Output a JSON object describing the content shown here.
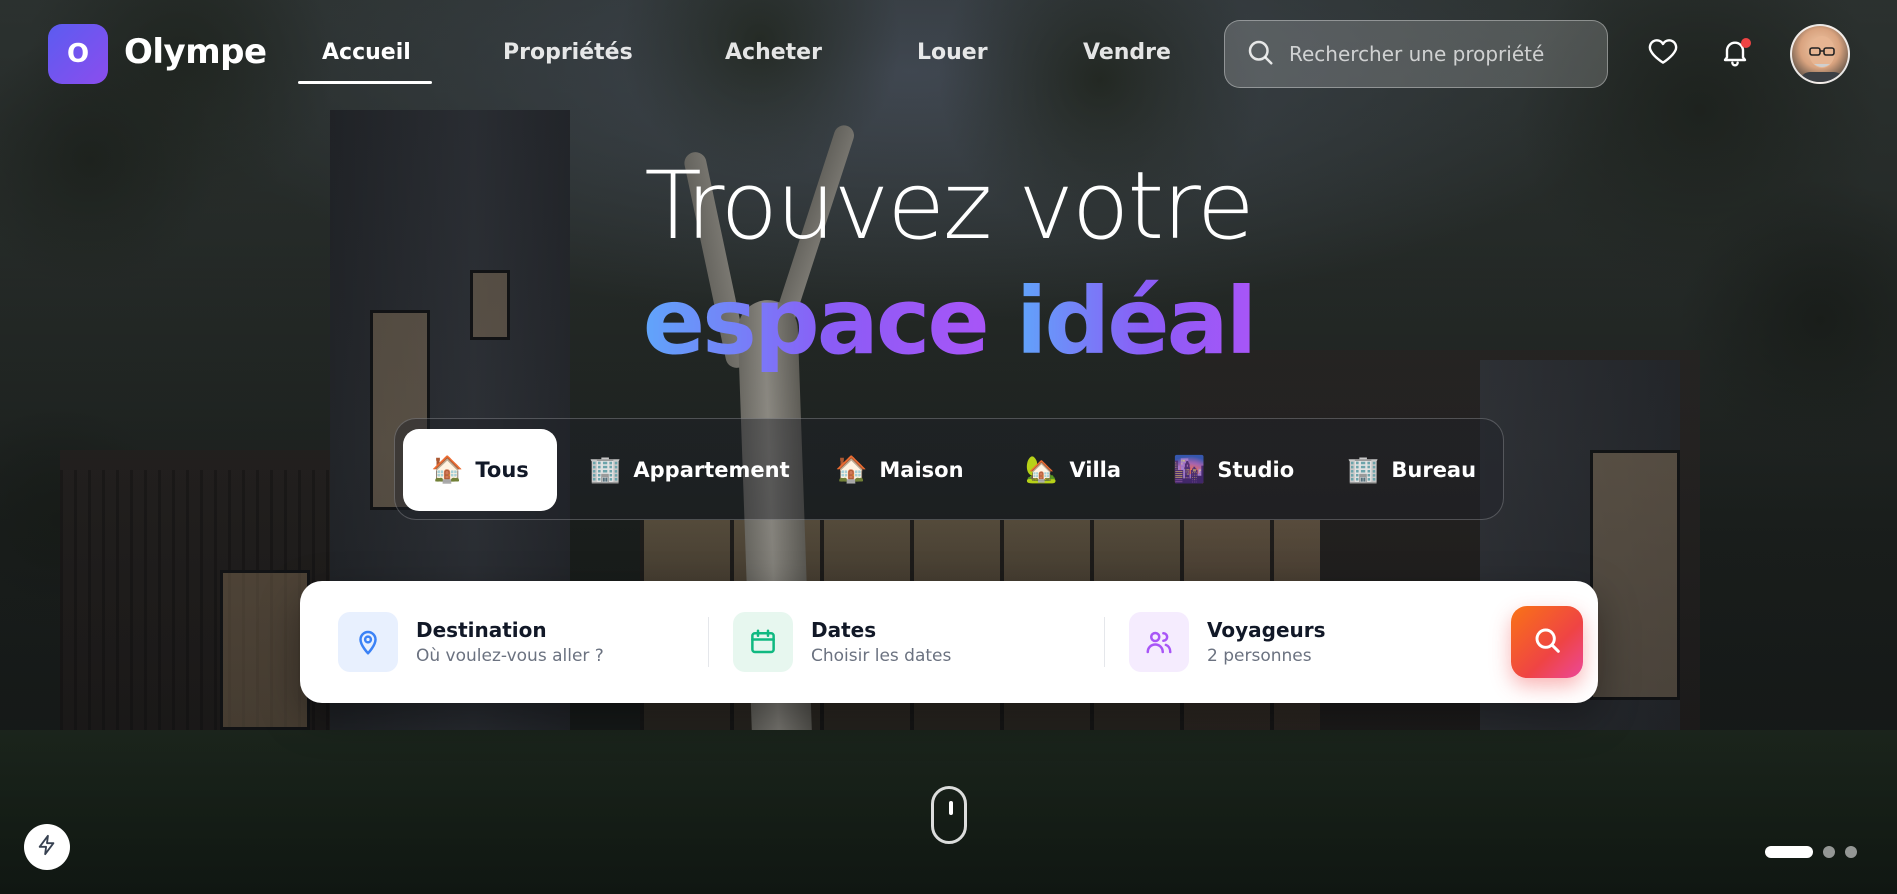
{
  "brand": {
    "logo_letter": "O",
    "name": "Olympe"
  },
  "nav": {
    "items": [
      {
        "label": "Accueil",
        "active": true
      },
      {
        "label": "Propriétés"
      },
      {
        "label": "Acheter"
      },
      {
        "label": "Louer"
      },
      {
        "label": "Vendre"
      }
    ]
  },
  "header_search": {
    "placeholder": "Rechercher une propriété"
  },
  "header_icons": {
    "favorites": "heart-icon",
    "notifications": "bell-icon",
    "notification_dot_color": "#ef4444"
  },
  "hero": {
    "line1": "Trouvez votre",
    "word1": "espace",
    "word2": "idéal",
    "gradient": [
      "#60a5fa",
      "#8b5cf6",
      "#a855f7"
    ]
  },
  "categories": [
    {
      "icon": "🏠",
      "label": "Tous",
      "active": true
    },
    {
      "icon": "🏢",
      "label": "Appartement"
    },
    {
      "icon": "🏠",
      "label": "Maison"
    },
    {
      "icon": "🏡",
      "label": "Villa"
    },
    {
      "icon": "🌆",
      "label": "Studio"
    },
    {
      "icon": "🏢",
      "label": "Bureau"
    }
  ],
  "search": {
    "destination": {
      "title": "Destination",
      "sub": "Où voulez-vous aller ?",
      "icon": "map-pin-icon",
      "color": "#3b82f6"
    },
    "dates": {
      "title": "Dates",
      "sub": "Choisir les dates",
      "icon": "calendar-icon",
      "color": "#10b981"
    },
    "travelers": {
      "title": "Voyageurs",
      "sub": "2 personnes",
      "icon": "users-icon",
      "color": "#a855f7"
    },
    "submit_icon": "search-icon",
    "accent": "#f97316"
  },
  "carousel": {
    "count": 3,
    "active_index": 0
  }
}
